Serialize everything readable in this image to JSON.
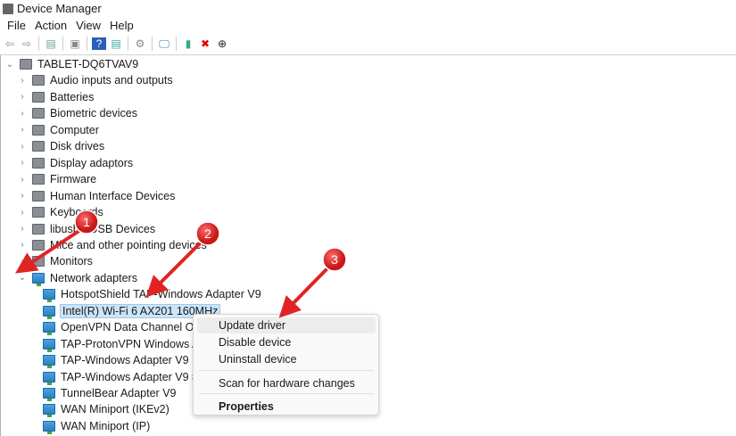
{
  "window": {
    "title": "Device Manager"
  },
  "menu": [
    "File",
    "Action",
    "View",
    "Help"
  ],
  "toolbar": [
    {
      "icon": "back-icon",
      "g": "⇦",
      "c": "#888"
    },
    {
      "icon": "forward-icon",
      "g": "⇨",
      "c": "#888"
    },
    {
      "sep": true
    },
    {
      "icon": "show-hide-console-tree-icon",
      "g": "▤",
      "c": "#6a8"
    },
    {
      "sep": true
    },
    {
      "icon": "properties-icon",
      "g": "▣",
      "c": "#888"
    },
    {
      "sep": true
    },
    {
      "icon": "help-icon",
      "g": "?",
      "c": "#fff",
      "bg": "#2b5fb8"
    },
    {
      "icon": "action-pane-icon",
      "g": "▤",
      "c": "#3a9"
    },
    {
      "sep": true
    },
    {
      "icon": "update-driver-icon",
      "g": "⚙",
      "c": "#888"
    },
    {
      "sep": true
    },
    {
      "icon": "scan-hardware-icon",
      "g": "🖵",
      "c": "#2c7fbf"
    },
    {
      "sep": true
    },
    {
      "icon": "enable-device-icon",
      "g": "▮",
      "c": "#3a8"
    },
    {
      "icon": "uninstall-icon",
      "g": "✖",
      "c": "#e00"
    },
    {
      "icon": "disable-device-icon",
      "g": "⊕",
      "c": "#222"
    }
  ],
  "tree": {
    "root": "TABLET-DQ6TVAV9",
    "categories": [
      "Audio inputs and outputs",
      "Batteries",
      "Biometric devices",
      "Computer",
      "Disk drives",
      "Display adaptors",
      "Firmware",
      "Human Interface Devices",
      "Keyboards",
      "libusbK USB Devices",
      "Mice and other pointing devices",
      "Monitors",
      "Network adapters"
    ],
    "expanded_index": 12,
    "network_children": [
      "HotspotShield TAP-Windows Adapter V9",
      "Intel(R) Wi-Fi 6 AX201 160MHz",
      "OpenVPN Data Channel Offload",
      "TAP-ProtonVPN Windows Adapter",
      "TAP-Windows Adapter V9",
      "TAP-Windows Adapter V9 #2",
      "TunnelBear Adapter V9",
      "WAN Miniport (IKEv2)",
      "WAN Miniport (IP)"
    ],
    "selected_child": 1
  },
  "context_menu": {
    "update": "Update driver",
    "disable": "Disable device",
    "uninstall": "Uninstall device",
    "scan": "Scan for hardware changes",
    "properties": "Properties"
  },
  "annotations": [
    "1",
    "2",
    "3"
  ],
  "colors": {
    "annotation": "#e02424",
    "selection": "#cce4f7"
  }
}
